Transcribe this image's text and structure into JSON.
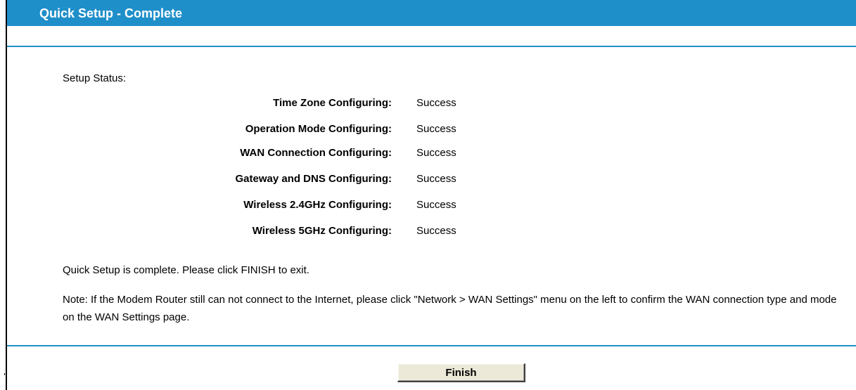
{
  "header": {
    "title": "Quick Setup - Complete"
  },
  "setup_status": {
    "label": "Setup Status:",
    "rows": [
      {
        "name": "Time Zone Configuring:",
        "status": "Success"
      },
      {
        "name": "Operation Mode Configuring:",
        "status": "Success"
      },
      {
        "name": "WAN Connection Configuring:",
        "status": "Success"
      },
      {
        "name": "Gateway and DNS Configuring:",
        "status": "Success"
      },
      {
        "name": "Wireless 2.4GHz Configuring:",
        "status": "Success"
      },
      {
        "name": "Wireless 5GHz Configuring:",
        "status": "Success"
      }
    ]
  },
  "message": "Quick Setup is complete. Please click FINISH to exit.",
  "note": "Note: If the Modem Router still can not connect to the Internet, please click \"Network > WAN Settings\" menu on the left to confirm the WAN connection type and mode on the WAN Settings page.",
  "finish_button": {
    "label": "Finish"
  },
  "colors": {
    "header_bg": "#1f8fca",
    "header_text": "#ffffff",
    "rule": "#1f8fca",
    "button_bg": "#ece9d8"
  }
}
